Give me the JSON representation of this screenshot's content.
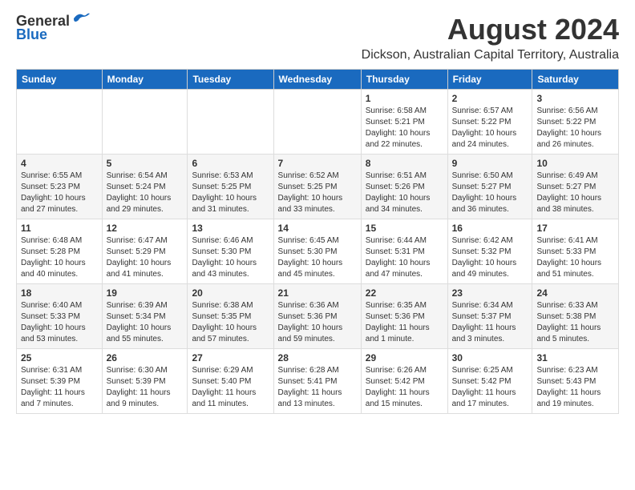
{
  "header": {
    "logo_general": "General",
    "logo_blue": "Blue",
    "title": "August 2024",
    "subtitle": "Dickson, Australian Capital Territory, Australia"
  },
  "calendar": {
    "days_of_week": [
      "Sunday",
      "Monday",
      "Tuesday",
      "Wednesday",
      "Thursday",
      "Friday",
      "Saturday"
    ],
    "weeks": [
      [
        {
          "day": "",
          "info": ""
        },
        {
          "day": "",
          "info": ""
        },
        {
          "day": "",
          "info": ""
        },
        {
          "day": "",
          "info": ""
        },
        {
          "day": "1",
          "info": "Sunrise: 6:58 AM\nSunset: 5:21 PM\nDaylight: 10 hours\nand 22 minutes."
        },
        {
          "day": "2",
          "info": "Sunrise: 6:57 AM\nSunset: 5:22 PM\nDaylight: 10 hours\nand 24 minutes."
        },
        {
          "day": "3",
          "info": "Sunrise: 6:56 AM\nSunset: 5:22 PM\nDaylight: 10 hours\nand 26 minutes."
        }
      ],
      [
        {
          "day": "4",
          "info": "Sunrise: 6:55 AM\nSunset: 5:23 PM\nDaylight: 10 hours\nand 27 minutes."
        },
        {
          "day": "5",
          "info": "Sunrise: 6:54 AM\nSunset: 5:24 PM\nDaylight: 10 hours\nand 29 minutes."
        },
        {
          "day": "6",
          "info": "Sunrise: 6:53 AM\nSunset: 5:25 PM\nDaylight: 10 hours\nand 31 minutes."
        },
        {
          "day": "7",
          "info": "Sunrise: 6:52 AM\nSunset: 5:25 PM\nDaylight: 10 hours\nand 33 minutes."
        },
        {
          "day": "8",
          "info": "Sunrise: 6:51 AM\nSunset: 5:26 PM\nDaylight: 10 hours\nand 34 minutes."
        },
        {
          "day": "9",
          "info": "Sunrise: 6:50 AM\nSunset: 5:27 PM\nDaylight: 10 hours\nand 36 minutes."
        },
        {
          "day": "10",
          "info": "Sunrise: 6:49 AM\nSunset: 5:27 PM\nDaylight: 10 hours\nand 38 minutes."
        }
      ],
      [
        {
          "day": "11",
          "info": "Sunrise: 6:48 AM\nSunset: 5:28 PM\nDaylight: 10 hours\nand 40 minutes."
        },
        {
          "day": "12",
          "info": "Sunrise: 6:47 AM\nSunset: 5:29 PM\nDaylight: 10 hours\nand 41 minutes."
        },
        {
          "day": "13",
          "info": "Sunrise: 6:46 AM\nSunset: 5:30 PM\nDaylight: 10 hours\nand 43 minutes."
        },
        {
          "day": "14",
          "info": "Sunrise: 6:45 AM\nSunset: 5:30 PM\nDaylight: 10 hours\nand 45 minutes."
        },
        {
          "day": "15",
          "info": "Sunrise: 6:44 AM\nSunset: 5:31 PM\nDaylight: 10 hours\nand 47 minutes."
        },
        {
          "day": "16",
          "info": "Sunrise: 6:42 AM\nSunset: 5:32 PM\nDaylight: 10 hours\nand 49 minutes."
        },
        {
          "day": "17",
          "info": "Sunrise: 6:41 AM\nSunset: 5:33 PM\nDaylight: 10 hours\nand 51 minutes."
        }
      ],
      [
        {
          "day": "18",
          "info": "Sunrise: 6:40 AM\nSunset: 5:33 PM\nDaylight: 10 hours\nand 53 minutes."
        },
        {
          "day": "19",
          "info": "Sunrise: 6:39 AM\nSunset: 5:34 PM\nDaylight: 10 hours\nand 55 minutes."
        },
        {
          "day": "20",
          "info": "Sunrise: 6:38 AM\nSunset: 5:35 PM\nDaylight: 10 hours\nand 57 minutes."
        },
        {
          "day": "21",
          "info": "Sunrise: 6:36 AM\nSunset: 5:36 PM\nDaylight: 10 hours\nand 59 minutes."
        },
        {
          "day": "22",
          "info": "Sunrise: 6:35 AM\nSunset: 5:36 PM\nDaylight: 11 hours\nand 1 minute."
        },
        {
          "day": "23",
          "info": "Sunrise: 6:34 AM\nSunset: 5:37 PM\nDaylight: 11 hours\nand 3 minutes."
        },
        {
          "day": "24",
          "info": "Sunrise: 6:33 AM\nSunset: 5:38 PM\nDaylight: 11 hours\nand 5 minutes."
        }
      ],
      [
        {
          "day": "25",
          "info": "Sunrise: 6:31 AM\nSunset: 5:39 PM\nDaylight: 11 hours\nand 7 minutes."
        },
        {
          "day": "26",
          "info": "Sunrise: 6:30 AM\nSunset: 5:39 PM\nDaylight: 11 hours\nand 9 minutes."
        },
        {
          "day": "27",
          "info": "Sunrise: 6:29 AM\nSunset: 5:40 PM\nDaylight: 11 hours\nand 11 minutes."
        },
        {
          "day": "28",
          "info": "Sunrise: 6:28 AM\nSunset: 5:41 PM\nDaylight: 11 hours\nand 13 minutes."
        },
        {
          "day": "29",
          "info": "Sunrise: 6:26 AM\nSunset: 5:42 PM\nDaylight: 11 hours\nand 15 minutes."
        },
        {
          "day": "30",
          "info": "Sunrise: 6:25 AM\nSunset: 5:42 PM\nDaylight: 11 hours\nand 17 minutes."
        },
        {
          "day": "31",
          "info": "Sunrise: 6:23 AM\nSunset: 5:43 PM\nDaylight: 11 hours\nand 19 minutes."
        }
      ]
    ]
  }
}
